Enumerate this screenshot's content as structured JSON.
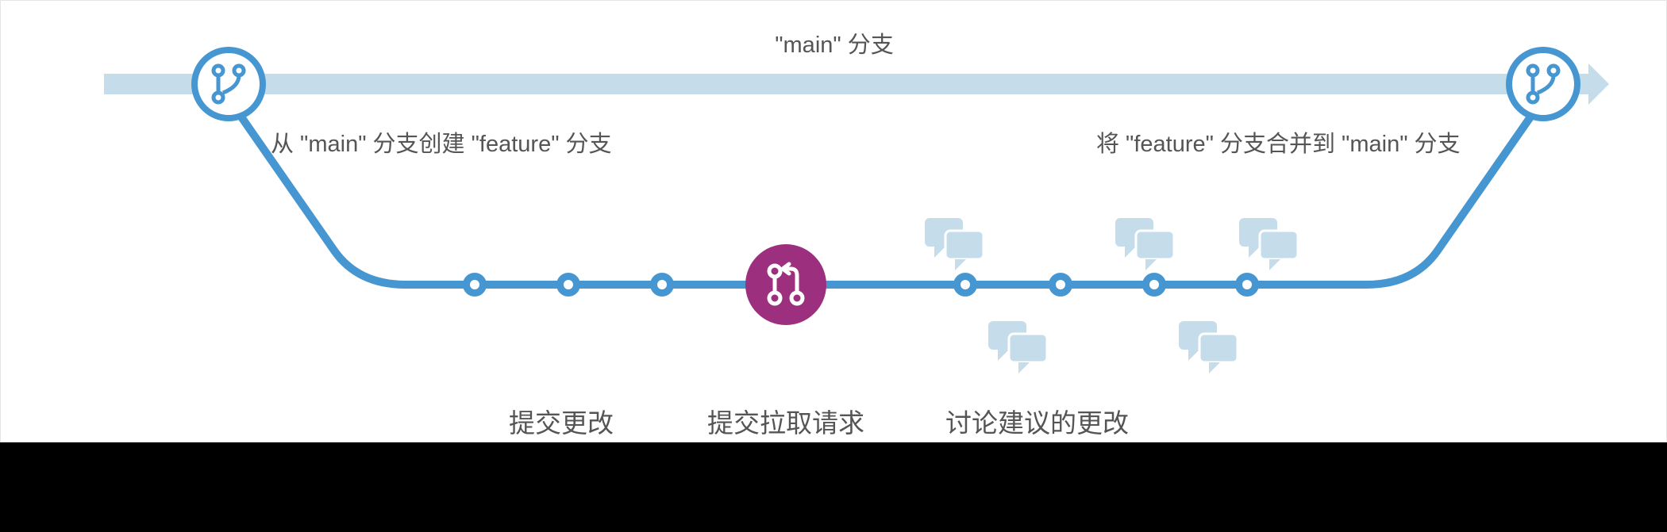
{
  "labels": {
    "main_branch": "\"main\" 分支",
    "create_feature": "从 \"main\" 分支创建 \"feature\" 分支",
    "merge_feature": "将 \"feature\" 分支合并到 \"main\" 分支",
    "commit_changes": "提交更改",
    "submit_pr": "提交拉取请求",
    "discuss_changes": "讨论建议的更改"
  },
  "colors": {
    "line": "#4696d2",
    "light": "#c5dceb",
    "pr": "#9c2f7e",
    "bubble": "#c5dceb"
  }
}
